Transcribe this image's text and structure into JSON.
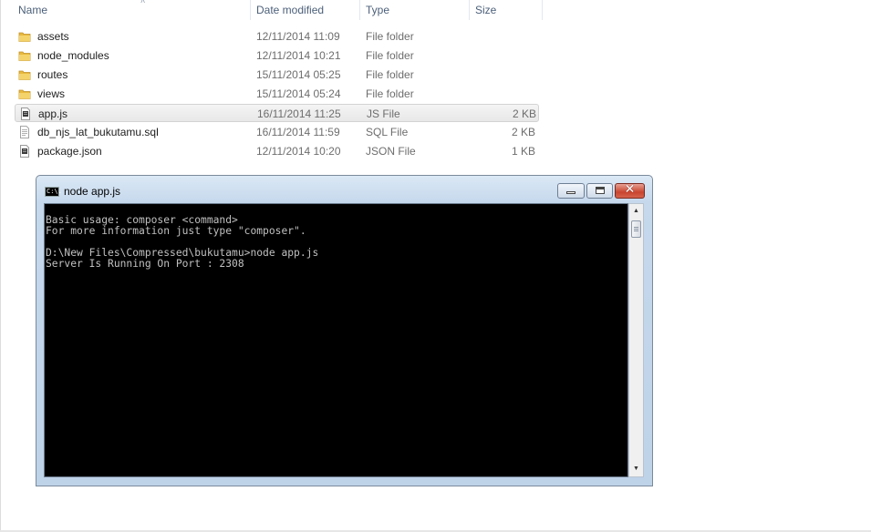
{
  "columns": {
    "name": "Name",
    "date_modified": "Date modified",
    "type": "Type",
    "size": "Size"
  },
  "files": [
    {
      "name": "assets",
      "date": "12/11/2014 11:09",
      "type": "File folder",
      "size": "",
      "icon": "folder-icon"
    },
    {
      "name": "node_modules",
      "date": "12/11/2014 10:21",
      "type": "File folder",
      "size": "",
      "icon": "folder-icon"
    },
    {
      "name": "routes",
      "date": "15/11/2014 05:25",
      "type": "File folder",
      "size": "",
      "icon": "folder-icon"
    },
    {
      "name": "views",
      "date": "15/11/2014 05:24",
      "type": "File folder",
      "size": "",
      "icon": "folder-icon"
    },
    {
      "name": "app.js",
      "date": "16/11/2014 11:25",
      "type": "JS File",
      "size": "2 KB",
      "icon": "script-file-icon",
      "selected": true
    },
    {
      "name": "db_njs_lat_bukutamu.sql",
      "date": "16/11/2014 11:59",
      "type": "SQL File",
      "size": "2 KB",
      "icon": "text-file-icon"
    },
    {
      "name": "package.json",
      "date": "12/11/2014 10:20",
      "type": "JSON File",
      "size": "1 KB",
      "icon": "script-file-icon"
    }
  ],
  "console_window": {
    "title": "node  app.js",
    "title_icon_text": "C:\\.",
    "output": "Basic usage: composer <command>\nFor more information just type \"composer\".\n\nD:\\New Files\\Compressed\\bukutamu>node app.js\nServer Is Running On Port : 2308",
    "close_glyph": "✕"
  }
}
